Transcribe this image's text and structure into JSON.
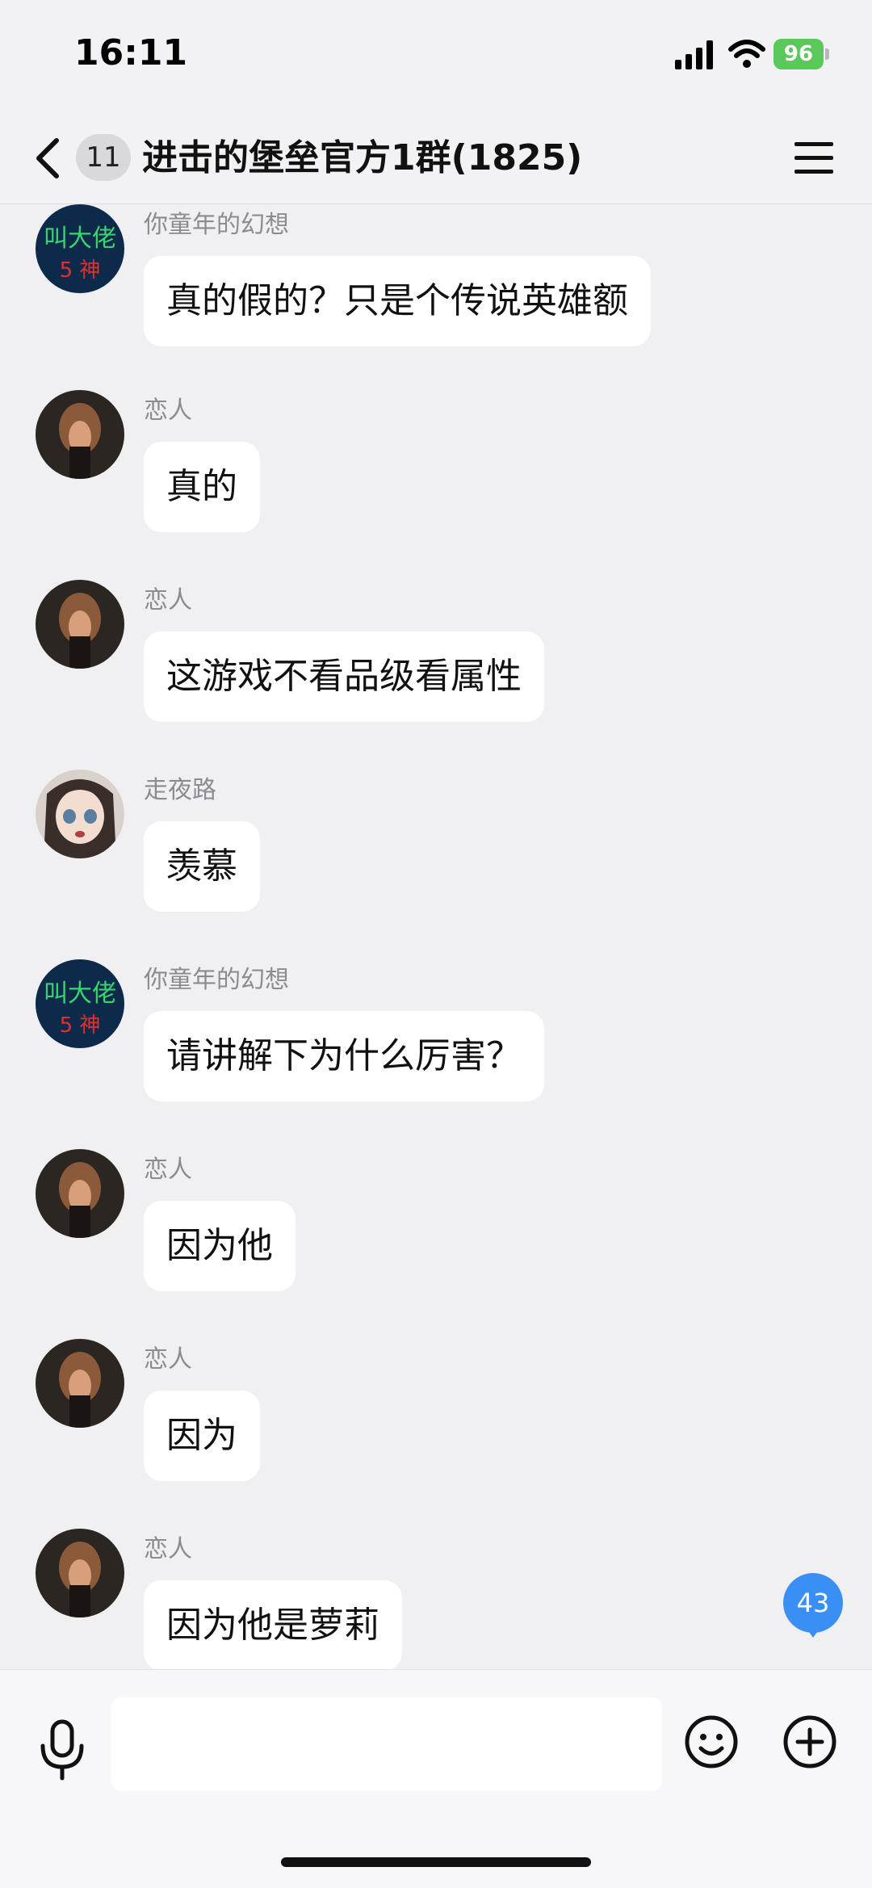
{
  "status_bar": {
    "time": "16:11",
    "battery": "96"
  },
  "header": {
    "unread_count": "11",
    "title": "进击的堡垒官方1群(1825)"
  },
  "messages": [
    {
      "sender": "你童年的幻想",
      "text": "真的假的？只是个传说英雄额"
    },
    {
      "sender": "恋人",
      "text": "真的"
    },
    {
      "sender": "恋人",
      "text": "这游戏不看品级看属性"
    },
    {
      "sender": "走夜路",
      "text": "羡慕"
    },
    {
      "sender": "你童年的幻想",
      "text": "请讲解下为什么厉害？"
    },
    {
      "sender": "恋人",
      "text": "因为他"
    },
    {
      "sender": "恋人",
      "text": "因为"
    },
    {
      "sender": "恋人",
      "text": "因为他是萝莉"
    }
  ],
  "avatar_art": {
    "text_line1": "叫大佬",
    "text_line2": "5 神"
  },
  "new_message_count": "43",
  "composer": {
    "placeholder": ""
  },
  "colors": {
    "accent": "#3a8ff5",
    "background": "#f0f0f2",
    "bubble": "#ffffff",
    "battery": "#5ac85a"
  }
}
